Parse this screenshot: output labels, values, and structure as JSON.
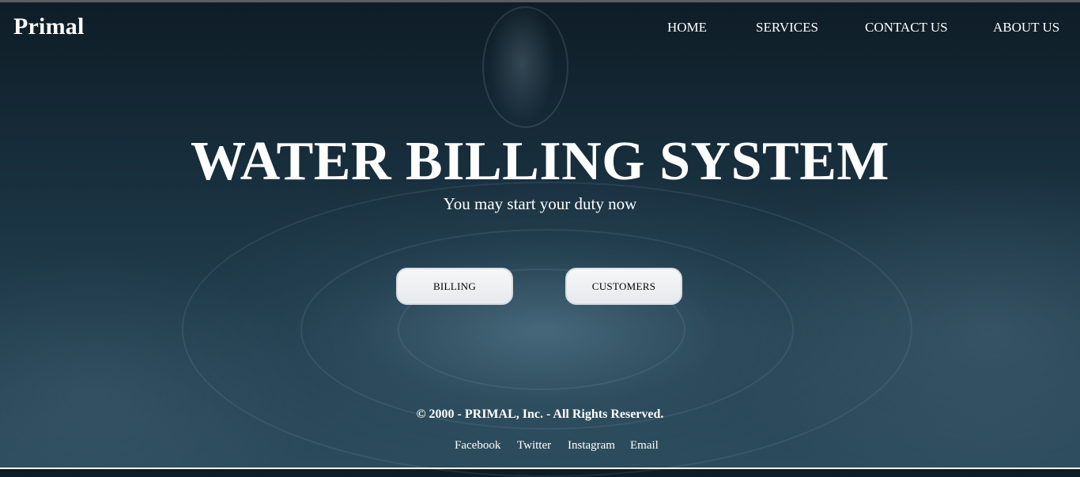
{
  "brand": "Primal",
  "nav": {
    "home": "HOME",
    "services": "SERVICES",
    "contact": "CONTACT US",
    "about": "ABOUT US"
  },
  "hero": {
    "title": "WATER BILLING SYSTEM",
    "subtitle": "You may start your duty now"
  },
  "actions": {
    "billing": "BILLING",
    "customers": "CUSTOMERS"
  },
  "footer": {
    "copyright": "© 2000 - PRIMAL, Inc. - All Rights Reserved.",
    "links": {
      "facebook": "Facebook",
      "twitter": "Twitter",
      "instagram": "Instagram",
      "email": "Email"
    }
  }
}
